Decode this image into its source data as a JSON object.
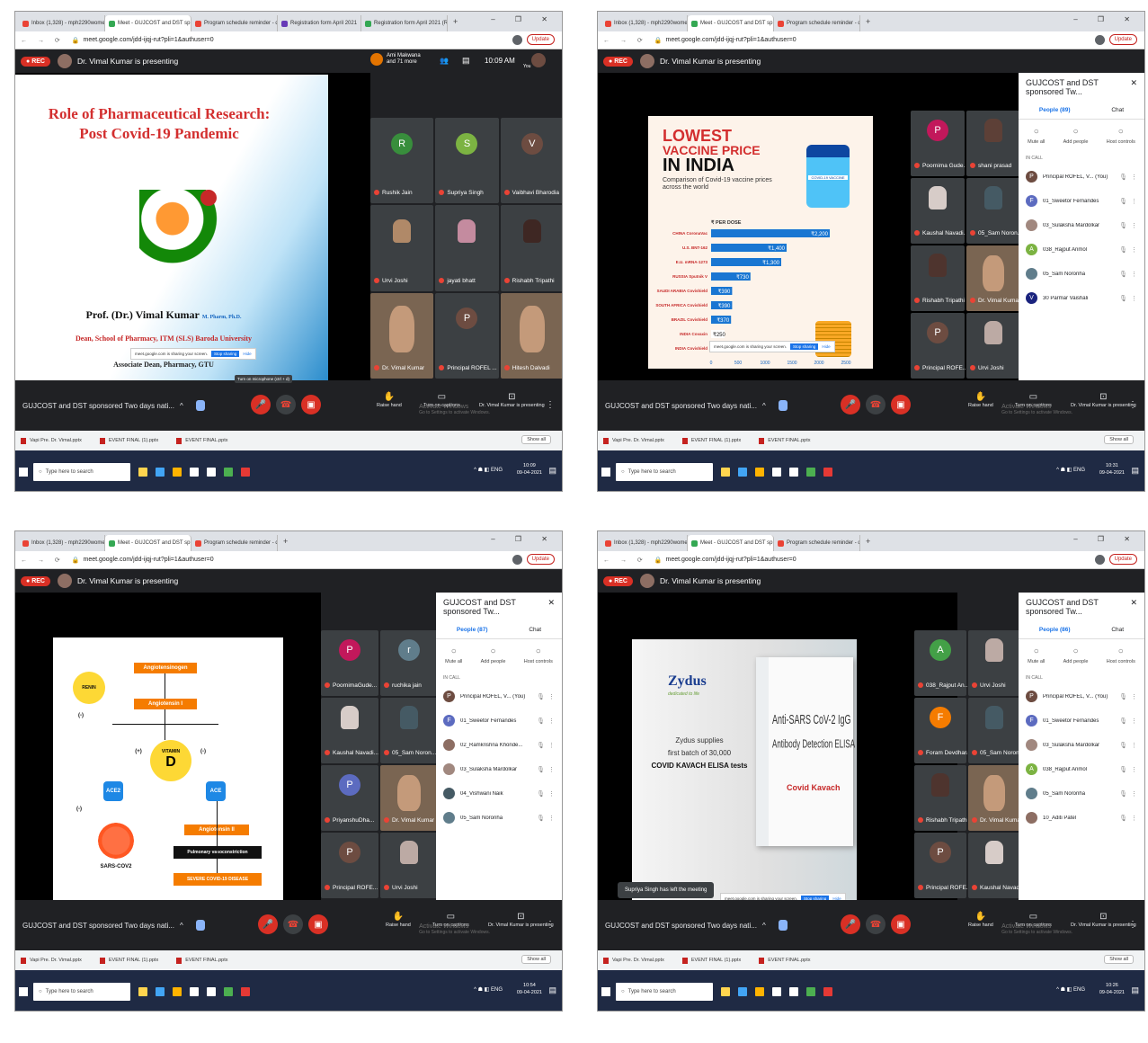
{
  "tabs": [
    "Inbox (1,328) - mph2290women@",
    "Meet - GUJCOST and DST sp",
    "Program schedule reminder - d",
    "Registration form April 2021",
    "Registration form April 2021 (Re"
  ],
  "url": "meet.google.com/jdd-ijqj-rut?pli=1&authuser=0",
  "update": "Update",
  "presenter": "Dr. Vimal Kumar is presenting",
  "rec": "REC",
  "meeting_name": "GUJCOST and DST sponsored Two days nati...",
  "raise_hand": "Raise hand",
  "captions": "Turn on captions",
  "presenting_label": "Dr. Vimal Kumar is presenting",
  "activate": "Activate Windows",
  "goto": "Go to Settings to activate Windows.",
  "downloads": [
    "Vapi Pre. Dr. Vimal.pptx",
    "EVENT FINAL (1).pptx",
    "EVENT FINAL.pptx"
  ],
  "show_all": "Show all",
  "search_placeholder": "Type here to search",
  "sharing": "meet.google.com is sharing your screen.",
  "stop_sharing": "Stop sharing",
  "hide": "Hide",
  "panel_title": "GUJCOST and DST sponsored Tw...",
  "chat": "Chat",
  "mute_all": "Mute all",
  "add_people": "Add people",
  "host_controls": "Host controls",
  "in_call": "IN CALL",
  "s1": {
    "top_attendees": "Ami Makwana and 71 more",
    "time": "10:09 AM",
    "you": "You",
    "slide_title1": "Role of Pharmaceutical Research:",
    "slide_title2": "Post Covid-19 Pandemic",
    "prof": "Prof. (Dr.) Vimal Kumar",
    "prof_deg": "M. Pharm, Ph.D.",
    "dean": "Dean, School of Pharmacy, ITM (SLS) Baroda University",
    "assoc": "Associate Dean, Pharmacy, GTU",
    "tooltip": "Turn on microphone (ctrl + d)",
    "tiles": [
      "Rushik Jain",
      "Supriya Singh",
      "Vaibhavi Bharodia",
      "Urvi Joshi",
      "jayati bhatt",
      "Rishabh Tripathi",
      "Dr. Vimal Kumar",
      "Principal ROFEL ...",
      "Hitesh Dalvadi"
    ],
    "tile_letters": [
      "R",
      "S",
      "V"
    ],
    "clock_time": "10:09",
    "clock_date": "09-04-2021"
  },
  "s2": {
    "people": "People (89)",
    "vac1": "LOWEST",
    "vac2": "VACCINE PRICE",
    "vac3": "IN INDIA",
    "vac_sub": "Comparison of Covid-19 vaccine prices across the world",
    "per_dose": "₹ PER DOSE",
    "bars": [
      {
        "n": "CHINA CoronaVac",
        "v": "₹2,200",
        "w": 2200
      },
      {
        "n": "U.S. BNT-162",
        "v": "₹1,400",
        "w": 1400
      },
      {
        "n": "E.U. mRNA-1273",
        "v": "₹1,300",
        "w": 1300
      },
      {
        "n": "RUSSIA Sputnik V",
        "v": "₹730",
        "w": 730
      },
      {
        "n": "SAUDI ARABIA Covishield",
        "v": "₹390",
        "w": 390
      },
      {
        "n": "SOUTH AFRICA Covishield",
        "v": "₹390",
        "w": 390
      },
      {
        "n": "BRAZIL Covishield",
        "v": "₹370",
        "w": 370
      },
      {
        "n": "INDIA Covaxin",
        "v": "₹250",
        "w": 250
      },
      {
        "n": "INDIA Covishield",
        "v": "",
        "w": 200
      }
    ],
    "axis": [
      "0",
      "500",
      "1000",
      "1500",
      "2000",
      "2500"
    ],
    "vial": "COVID-19 VACCINE",
    "tiles": [
      "Poornima Gude...",
      "shani prasad",
      "Kaushal Navadi...",
      "05_Sam Noron...",
      "Rishabh Tripathi",
      "Dr. Vimal Kumar",
      "Principal ROFE...",
      "Urvi Joshi"
    ],
    "list": [
      {
        "n": "Principal ROFEL, V... (You)",
        "l": "P",
        "c": "#6d4c41"
      },
      {
        "n": "01_Sweetor Fernandes",
        "l": "F",
        "c": "#5c6bc0"
      },
      {
        "n": "03_Sulaksha Mardolkar",
        "l": "",
        "c": "#a1887f"
      },
      {
        "n": "038_Rajput Anmol",
        "l": "A",
        "c": "#7cb342"
      },
      {
        "n": "05_Sam Noronha",
        "l": "",
        "c": "#607d8b"
      },
      {
        "n": "30 Parmar Vaishali",
        "l": "V",
        "c": "#1a237e"
      }
    ],
    "clock_time": "10:31",
    "clock_date": "09-04-2021"
  },
  "s3": {
    "people": "People (87)",
    "renin": "RENIN",
    "angiotensinogen": "Angiotensinogen",
    "ang1": "Angiotensin I",
    "vitd1": "VITAMIN",
    "vitd2": "D",
    "ace2": "ACE2",
    "ace": "ACE",
    "ang2": "Angiotensin II",
    "pulm": "Pulmonary vasoconstriction",
    "severe": "SEVERE COVID-19 DISEASE",
    "sars": "SARS-COV2",
    "plus": "(+)",
    "minus": "(-)",
    "tiles": [
      "PoornimaGude...",
      "ruchika jain",
      "Kaushal Navadi...",
      "05_Sam Noron...",
      "PriyanshuDha...",
      "Dr. Vimal Kumar",
      "Principal ROFE...",
      "Urvi Joshi"
    ],
    "list": [
      {
        "n": "Principal ROFEL, V... (You)",
        "l": "P",
        "c": "#6d4c41"
      },
      {
        "n": "01_Sweetor Fernandes",
        "l": "F",
        "c": "#5c6bc0"
      },
      {
        "n": "02_Ramkrishna Khonde...",
        "l": "",
        "c": "#8d6e63"
      },
      {
        "n": "03_Sulaksha Mardolkar",
        "l": "",
        "c": "#a1887f"
      },
      {
        "n": "04_Vishwani Naik",
        "l": "",
        "c": "#455a64"
      },
      {
        "n": "05_Sam Noronha",
        "l": "",
        "c": "#607d8b"
      }
    ],
    "clock_time": "10:54",
    "clock_date": "09-04-2021"
  },
  "s4": {
    "people": "People (86)",
    "zydus": "Zydus",
    "zydus_tag": "dedicated to life",
    "supplies1": "Zydus supplies",
    "supplies2": "first batch of 30,000",
    "supplies3": "COVID KAVACH ELISA tests",
    "box1": "Anti-SARS CoV-2 IgG",
    "box2": "Antibody Detection ELISA",
    "kavach": "Covid Kavach",
    "left_msg": "Supriya Singh has left the meeting",
    "tiles": [
      "038_Rajput An...",
      "Urvi Joshi",
      "Foram Devdhara",
      "05_Sam Noron...",
      "Rishabh Tripathi",
      "Dr. Vimal Kumar",
      "Principal ROFE...",
      "Kaushal Navadi..."
    ],
    "list": [
      {
        "n": "Principal ROFEL, V... (You)",
        "l": "P",
        "c": "#6d4c41"
      },
      {
        "n": "01_Sweetor Fernandes",
        "l": "F",
        "c": "#5c6bc0"
      },
      {
        "n": "03_Sulaksha Mardolkar",
        "l": "",
        "c": "#a1887f"
      },
      {
        "n": "038_Rajput Anmol",
        "l": "A",
        "c": "#7cb342"
      },
      {
        "n": "05_Sam Noronha",
        "l": "",
        "c": "#607d8b"
      },
      {
        "n": "10_Aditi Patel",
        "l": "",
        "c": "#8d6e63"
      }
    ],
    "clock_time": "10:26",
    "clock_date": "09-04-2021"
  }
}
